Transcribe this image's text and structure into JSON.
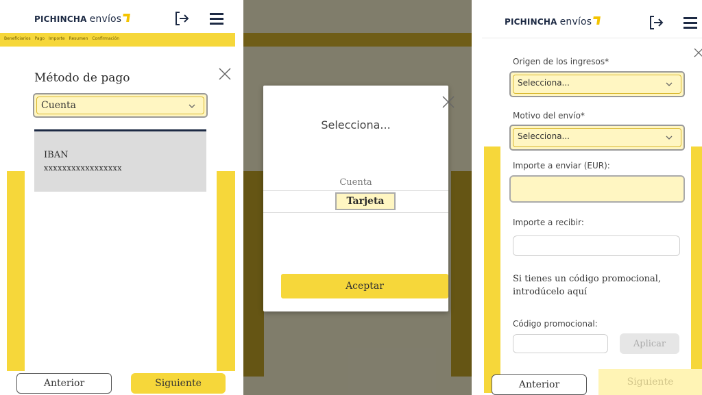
{
  "brand": {
    "name_bold": "PICHINCHA",
    "name_light": "envíos"
  },
  "icons": {
    "logout": "logout-icon",
    "menu": "hamburger-menu-icon",
    "close": "close-icon",
    "chevron": "chevron-down-icon"
  },
  "colors": {
    "accent_yellow": "#f6d73a",
    "highlight_fill": "#fff6c2",
    "navy": "#1d2a44"
  },
  "screen1": {
    "breadcrumb": [
      "Beneficiarios",
      "Pago",
      "Importe",
      "Resumen",
      "Confirmación"
    ],
    "title": "Método de pago",
    "select_value": "Cuenta",
    "account_label": "IBAN",
    "account_number": "xxxxxxxxxxxxxxxxx",
    "prev_button": "Anterior",
    "next_button": "Siguiente"
  },
  "screen2": {
    "title": "Selecciona...",
    "options": [
      "Cuenta",
      "Tarjeta"
    ],
    "selected_option": "Tarjeta",
    "accept_button": "Aceptar"
  },
  "screen3": {
    "origin_label": "Origen de los ingresos*",
    "origin_value": "Selecciona...",
    "reason_label": "Motivo del envío*",
    "reason_value": "Selecciona...",
    "send_label": "Importe a enviar (EUR):",
    "send_value": "",
    "receive_label": "Importe a recibir:",
    "receive_value": "",
    "promo_text": "Si tienes un código promocional, introdúcelo aquí",
    "promo_label": "Código promocional:",
    "promo_value": "",
    "apply_button": "Aplicar",
    "prev_button": "Anterior",
    "next_button": "Siguiente"
  }
}
